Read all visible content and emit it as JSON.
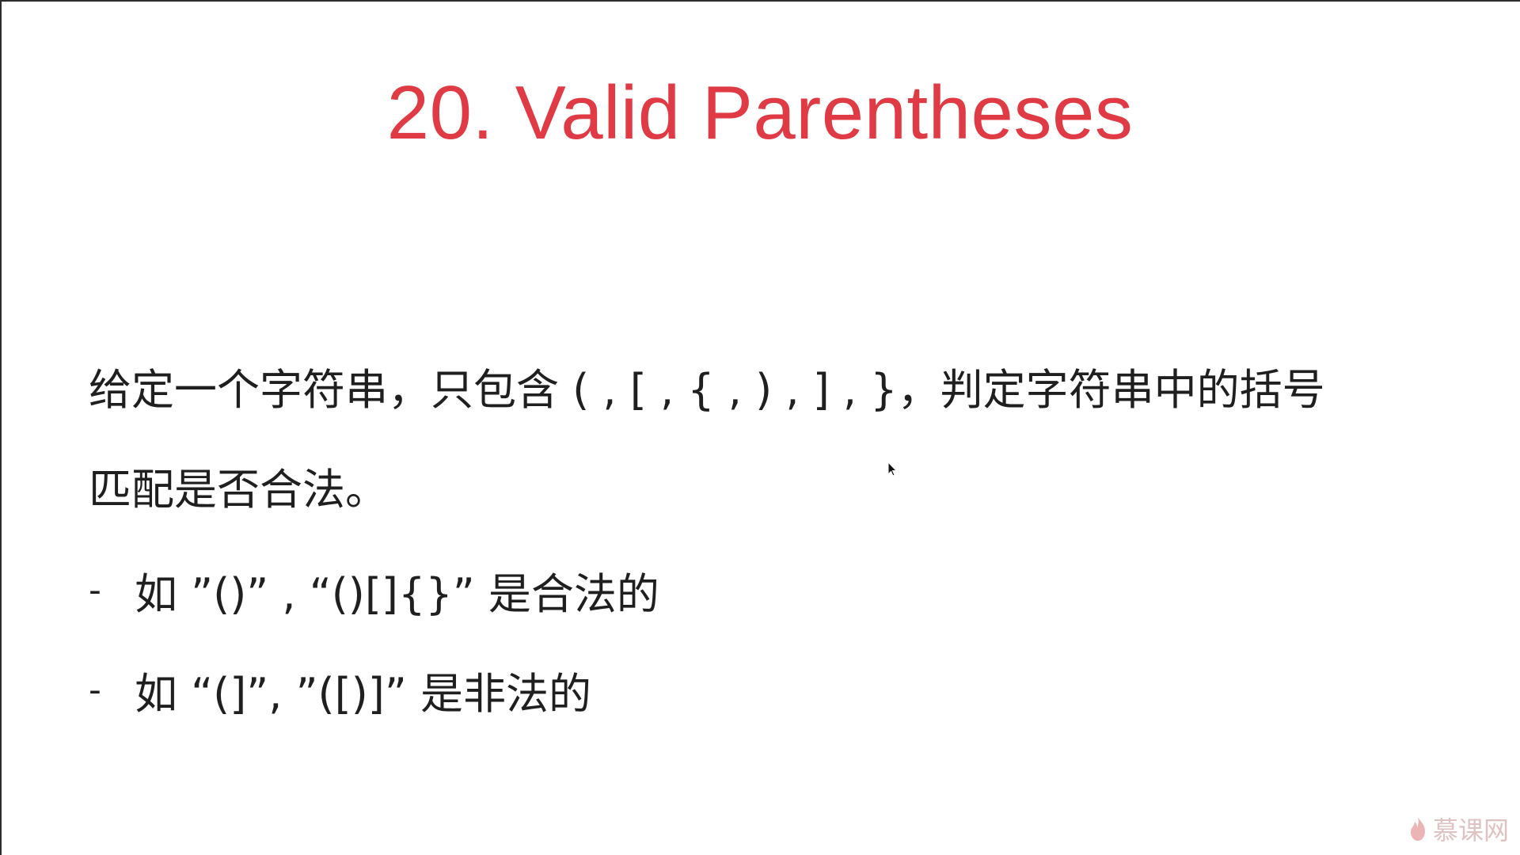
{
  "slide": {
    "title": "20. Valid Parentheses",
    "paragraph_line1": "给定一个字符串，只包含 ( , [ , { , ) , ] , }，判定字符串中的括号",
    "paragraph_line2": "匹配是否合法。",
    "bullets": [
      {
        "dash": "-",
        "text": "如 ”()” , “()[]{}” 是合法的"
      },
      {
        "dash": "-",
        "text": "如 “(]”,  ”([)]” 是非法的"
      }
    ]
  },
  "watermark": {
    "text": "慕课网",
    "icon": "flame-icon"
  },
  "colors": {
    "title": "#e03a45",
    "text": "#1f1f1f",
    "watermark": "#d9b3b3"
  }
}
